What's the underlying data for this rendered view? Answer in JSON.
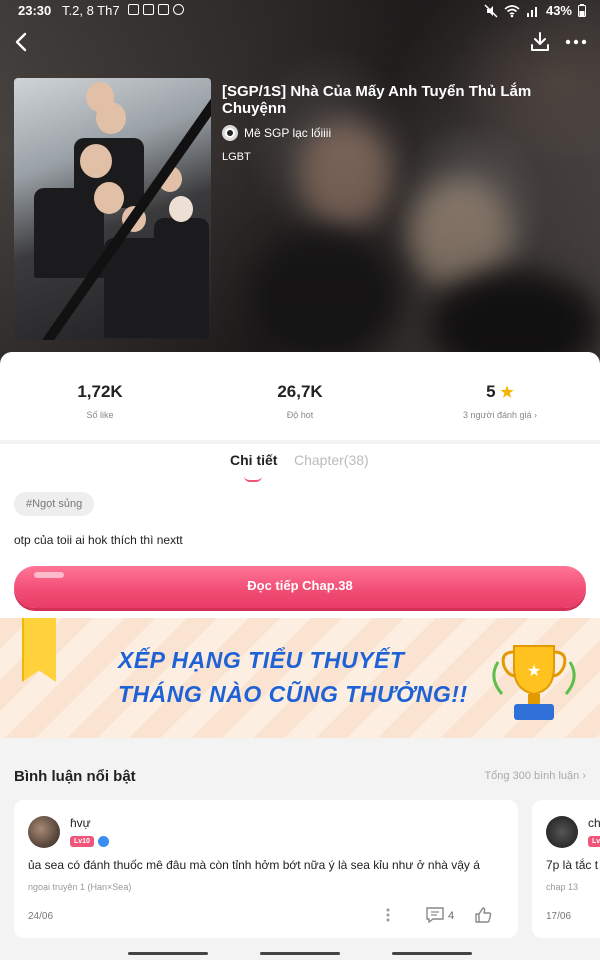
{
  "status_bar": {
    "time": "23:30",
    "date": "T.2, 8 Th7",
    "battery": "43%"
  },
  "story": {
    "title": "[SGP/1S] Nhà Của Mấy Anh Tuyển Thủ Lắm Chuyệnn",
    "author": "Mê SGP lạc lốiiii",
    "genre": "LGBT"
  },
  "stats": {
    "likes": "1,72K",
    "likes_label": "Số like",
    "hot": "26,7K",
    "hot_label": "Độ hot",
    "rating": "5",
    "rating_label": "3 người đánh giá"
  },
  "tabs": {
    "details": "Chi tiết",
    "chapters": "Chapter(38)"
  },
  "tag": "#Ngọt sủng",
  "description": "otp của toii ai hok thích thì nextt",
  "read_button": "Đọc tiếp Chap.38",
  "banner": {
    "line1": "XẾP HẠNG TIỂU THUYẾT",
    "line2": "THÁNG NÀO CŨNG THƯỞNG!!"
  },
  "comments": {
    "title": "Bình luận nổi bật",
    "total": "Tổng 300 bình luận",
    "items": [
      {
        "name": "ɦvự",
        "level": "Lv10",
        "text": "ủa sea có đánh thuốc mê đâu mà còn tỉnh hởm bớt nữa ý là sea kỉu như ở nhà vậy á",
        "source": "ngoại truyện 1 (Han×Sea)",
        "date": "24/06",
        "reply_count": "4"
      },
      {
        "name": "ch",
        "level": "Lv",
        "text": "7p là tắc t",
        "source": "chap 13",
        "date": "17/06"
      }
    ]
  },
  "colors": {
    "accent": "#f14c73",
    "banner_text": "#1f62d6",
    "star": "#f5b400"
  }
}
